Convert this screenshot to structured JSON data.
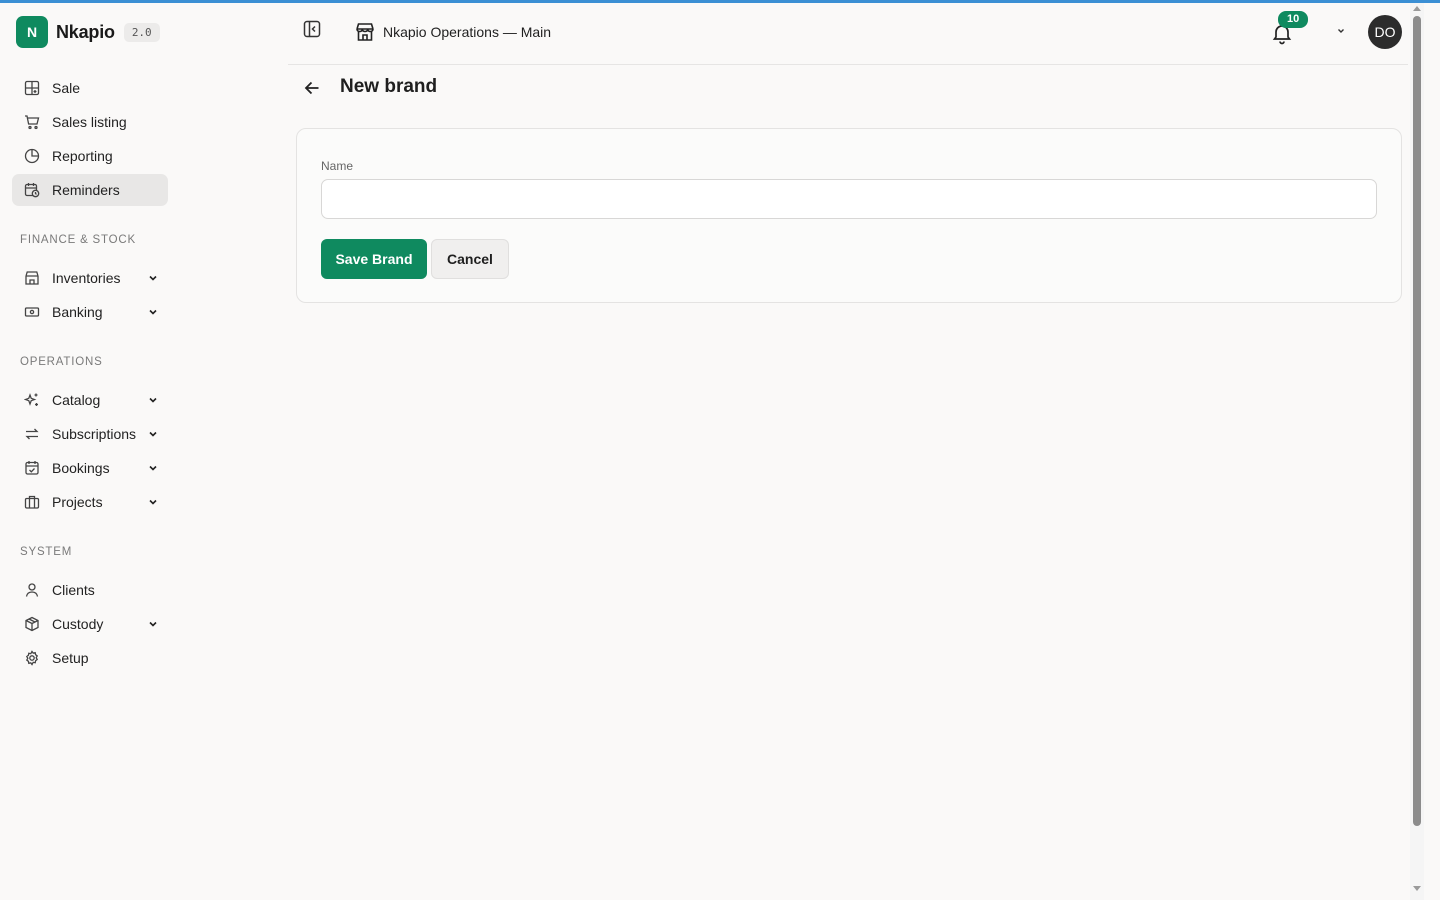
{
  "app": {
    "name": "Nkapio",
    "logo_letter": "N",
    "version": "2.0",
    "accent": "#0f8a5f"
  },
  "sidebar": {
    "top_items": [
      {
        "label": "Sale",
        "icon": "grid-plus-icon"
      },
      {
        "label": "Sales listing",
        "icon": "cart-icon"
      },
      {
        "label": "Reporting",
        "icon": "pie-chart-icon"
      },
      {
        "label": "Reminders",
        "icon": "calendar-clock-icon",
        "active": true
      }
    ],
    "sections": [
      {
        "label": "FINANCE & STOCK",
        "items": [
          {
            "label": "Inventories",
            "icon": "store-icon",
            "expandable": true
          },
          {
            "label": "Banking",
            "icon": "banknote-icon",
            "expandable": true
          }
        ]
      },
      {
        "label": "OPERATIONS",
        "items": [
          {
            "label": "Catalog",
            "icon": "sparkles-icon",
            "expandable": true
          },
          {
            "label": "Subscriptions",
            "icon": "repeat-icon",
            "expandable": true
          },
          {
            "label": "Bookings",
            "icon": "calendar-check-icon",
            "expandable": true
          },
          {
            "label": "Projects",
            "icon": "briefcase-icon",
            "expandable": true
          }
        ]
      },
      {
        "label": "SYSTEM",
        "items": [
          {
            "label": "Clients",
            "icon": "user-icon",
            "expandable": false
          },
          {
            "label": "Custody",
            "icon": "package-icon",
            "expandable": true
          },
          {
            "label": "Setup",
            "icon": "gear-icon",
            "expandable": false
          }
        ]
      }
    ]
  },
  "header": {
    "store_name": "Nkapio Operations — Main",
    "notification_count": "10",
    "user_initials": "DO"
  },
  "page": {
    "title": "New brand"
  },
  "form": {
    "name_label": "Name",
    "name_value": "",
    "name_placeholder": "",
    "save_label": "Save Brand",
    "cancel_label": "Cancel"
  }
}
